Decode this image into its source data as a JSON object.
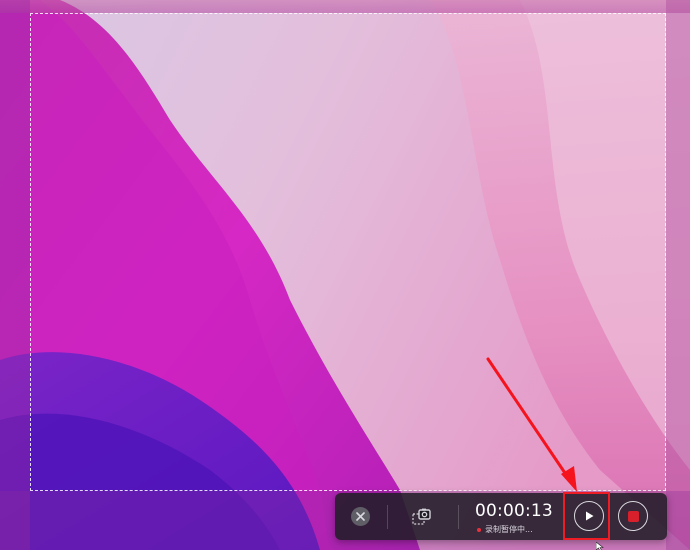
{
  "recorder": {
    "elapsed_time": "00:00:13",
    "status_text": "录制暂停中...",
    "close_icon": "close-icon",
    "screenshot_icon": "camera-icon",
    "resume_icon": "play-icon",
    "stop_icon": "stop-icon"
  },
  "colors": {
    "toolbar_bg": "#1e1c24",
    "status_dot": "#e8303c",
    "stop_square": "#d8202c",
    "highlight_box": "#ee1c24",
    "arrow": "#f5141e"
  }
}
